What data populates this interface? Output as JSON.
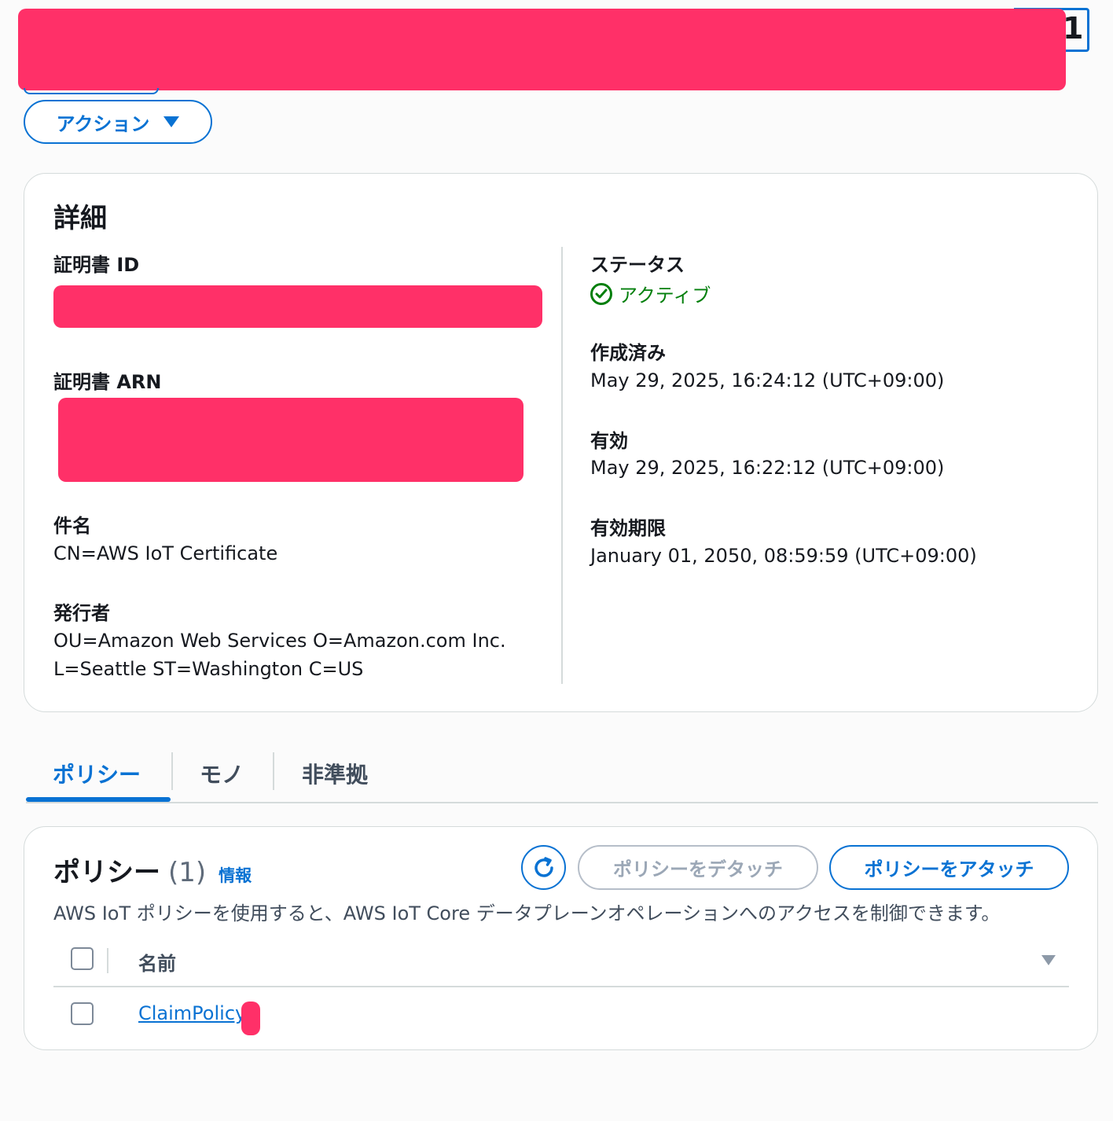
{
  "header": {
    "title_tail": "1"
  },
  "actions": {
    "label": "アクション"
  },
  "details": {
    "title": "詳細",
    "certificate_id_label": "証明書 ID",
    "certificate_arn_label": "証明書 ARN",
    "subject_label": "件名",
    "subject_value": "CN=AWS IoT Certificate",
    "issuer_label": "発行者",
    "issuer_line1": "OU=Amazon Web Services O=Amazon.com Inc.",
    "issuer_line2": "L=Seattle ST=Washington C=US",
    "status_label": "ステータス",
    "status_value": "アクティブ",
    "created_label": "作成済み",
    "created_value": "May 29, 2025, 16:24:12 (UTC+09:00)",
    "valid_label": "有効",
    "valid_value": "May 29, 2025, 16:22:12 (UTC+09:00)",
    "expiry_label": "有効期限",
    "expiry_value": "January 01, 2050, 08:59:59 (UTC+09:00)"
  },
  "tabs": [
    {
      "label": "ポリシー",
      "active": true
    },
    {
      "label": "モノ",
      "active": false
    },
    {
      "label": "非準拠",
      "active": false
    }
  ],
  "policies": {
    "title": "ポリシー",
    "count": "(1)",
    "info": "情報",
    "detach_label": "ポリシーをデタッチ",
    "attach_label": "ポリシーをアタッチ",
    "description": "AWS IoT ポリシーを使用すると、AWS IoT Core データプレーンオペレーションへのアクセスを制御できます。",
    "column_name": "名前",
    "rows": [
      {
        "name": "ClaimPolicy"
      }
    ]
  },
  "colors": {
    "accent": "#0972d3",
    "success": "#037f0c",
    "redaction": "#ff3068",
    "border": "#d5dbdb"
  },
  "icons": [
    "caret-down-icon",
    "check-circle-icon",
    "refresh-icon",
    "sort-caret-icon"
  ]
}
